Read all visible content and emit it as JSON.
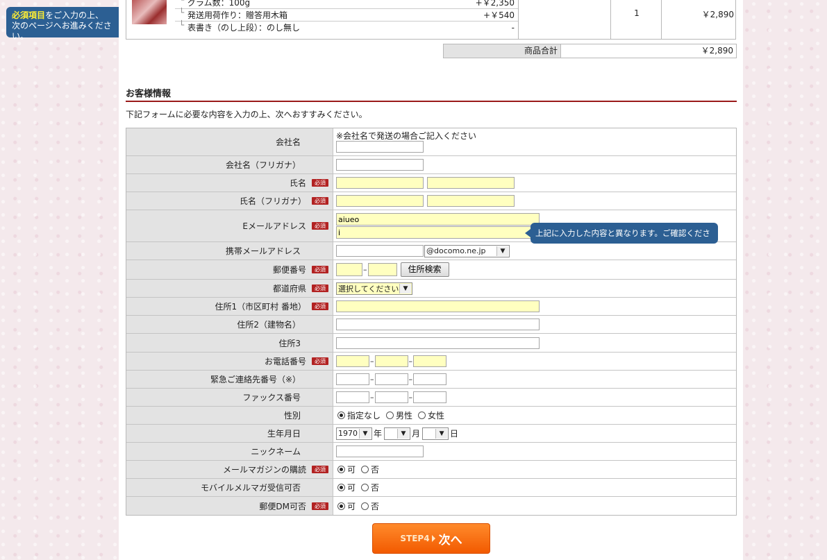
{
  "note": {
    "highlight": "必須項目",
    "line1_rest": "をご入力の上、",
    "line2": "次のページへお進みください。"
  },
  "cart": {
    "options": [
      {
        "name": "グラム数：100g",
        "price": "+￥2,350"
      },
      {
        "name": "発送用荷作り：贈答用木箱",
        "price": "+￥540"
      },
      {
        "name": "表書き（のし上段）：のし無し",
        "price": "-"
      }
    ],
    "quantity": "1",
    "subtotal": "￥2,890",
    "total_label": "商品合計",
    "total_value": "￥2,890"
  },
  "section": {
    "title": "お客様情報",
    "intro": "下記フォームに必要な内容を入力の上、次へおすすみください。"
  },
  "required_badge": "必須",
  "form": {
    "company": {
      "label": "会社名",
      "note": "※会社名で発送の場合ご記入ください"
    },
    "company_kana": {
      "label": "会社名（フリガナ）"
    },
    "name": {
      "label": "氏名"
    },
    "name_kana": {
      "label": "氏名（フリガナ）"
    },
    "email": {
      "label": "Eメールアドレス",
      "value1": "aiueo",
      "value2": "i"
    },
    "mobile_email": {
      "label": "携帯メールアドレス",
      "domain": "@docomo.ne.jp"
    },
    "zip": {
      "label": "郵便番号",
      "search_button": "住所検索"
    },
    "prefecture": {
      "label": "都道府県",
      "selected": "選択してください"
    },
    "address1": {
      "label": "住所1（市区町村  番地）"
    },
    "address2": {
      "label": "住所2（建物名）"
    },
    "address3": {
      "label": "住所3"
    },
    "phone": {
      "label": "お電話番号"
    },
    "emergency": {
      "label": "緊急ご連絡先番号（※）"
    },
    "fax": {
      "label": "ファックス番号"
    },
    "gender": {
      "label": "性別",
      "options": [
        "指定なし",
        "男性",
        "女性"
      ]
    },
    "birthday": {
      "label": "生年月日",
      "year": "1970",
      "year_unit": "年",
      "month_unit": "月",
      "day_unit": "日"
    },
    "nickname": {
      "label": "ニックネーム"
    },
    "magazine": {
      "label": "メールマガジンの購読",
      "yes": "可",
      "no": "否"
    },
    "mobile_magazine": {
      "label": "モバイルメルマガ受信可否",
      "yes": "可",
      "no": "否"
    },
    "postal_dm": {
      "label": "郵便DM可否",
      "yes": "可",
      "no": "否"
    }
  },
  "tooltip": "上記に入力した内容と異なります。ご確認ください。",
  "next": {
    "step": "STEP4",
    "label": "次へ"
  }
}
